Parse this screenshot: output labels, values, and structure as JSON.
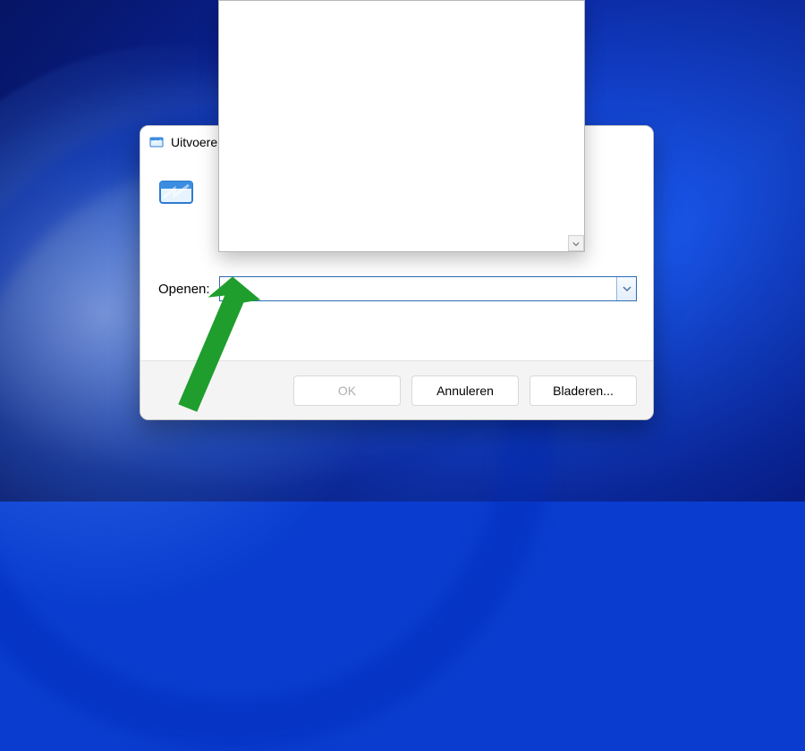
{
  "dialog": {
    "title": "Uitvoeren",
    "open_label": "Openen:",
    "open_value": "",
    "ok_label": "OK",
    "cancel_label": "Annuleren",
    "browse_label": "Bladeren..."
  },
  "icons": {
    "run_small": "run-icon-small",
    "run_large": "run-icon-large",
    "chevron_down": "chevron-down-icon",
    "chevron_down_sb": "chevron-down-icon"
  }
}
